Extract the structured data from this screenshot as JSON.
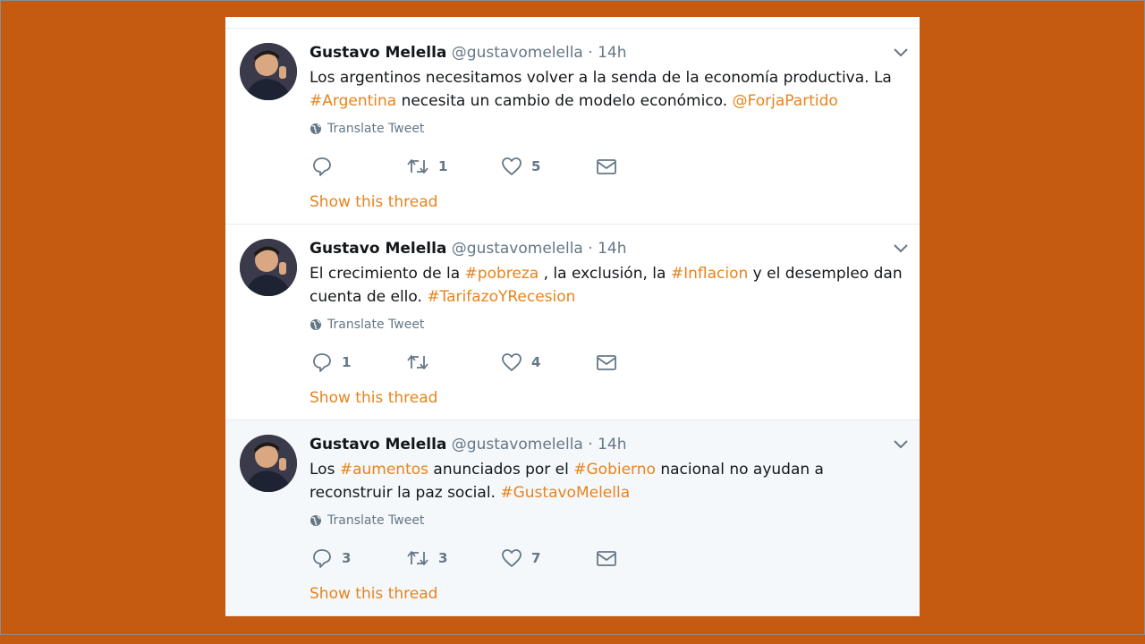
{
  "tweets": [
    {
      "name": "Gustavo Melella",
      "handle": "@gustavomelella",
      "separator": "·",
      "time": "14h",
      "segments": [
        {
          "text": "Los argentinos necesitamos volver a la senda de la economía productiva. La ",
          "link": false
        },
        {
          "text": "#Argentina",
          "link": true
        },
        {
          "text": " necesita un cambio de modelo económico. ",
          "link": false
        },
        {
          "text": "@ForjaPartido",
          "link": true
        }
      ],
      "translate_label": "Translate Tweet",
      "replies": "",
      "retweets": "1",
      "likes": "5",
      "show_thread": "Show this thread",
      "highlighted": false
    },
    {
      "name": "Gustavo Melella",
      "handle": "@gustavomelella",
      "separator": "·",
      "time": "14h",
      "segments": [
        {
          "text": "El crecimiento de la ",
          "link": false
        },
        {
          "text": "#pobreza",
          "link": true
        },
        {
          "text": " , la exclusión, la ",
          "link": false
        },
        {
          "text": "#Inflacion",
          "link": true
        },
        {
          "text": " y el desempleo dan cuenta de ello. ",
          "link": false
        },
        {
          "text": "#TarifazoYRecesion",
          "link": true
        }
      ],
      "translate_label": "Translate Tweet",
      "replies": "1",
      "retweets": "",
      "likes": "4",
      "show_thread": "Show this thread",
      "highlighted": false
    },
    {
      "name": "Gustavo Melella",
      "handle": "@gustavomelella",
      "separator": "·",
      "time": "14h",
      "segments": [
        {
          "text": "Los ",
          "link": false
        },
        {
          "text": "#aumentos",
          "link": true
        },
        {
          "text": " anunciados por el ",
          "link": false
        },
        {
          "text": "#Gobierno",
          "link": true
        },
        {
          "text": " nacional no ayudan a reconstruir la paz social. ",
          "link": false
        },
        {
          "text": "#GustavoMelella",
          "link": true
        }
      ],
      "translate_label": "Translate Tweet",
      "replies": "3",
      "retweets": "3",
      "likes": "7",
      "show_thread": "Show this thread",
      "highlighted": true
    }
  ],
  "colors": {
    "background": "#c55a11",
    "link": "#e8831c",
    "text": "#14171a",
    "muted": "#657786"
  }
}
